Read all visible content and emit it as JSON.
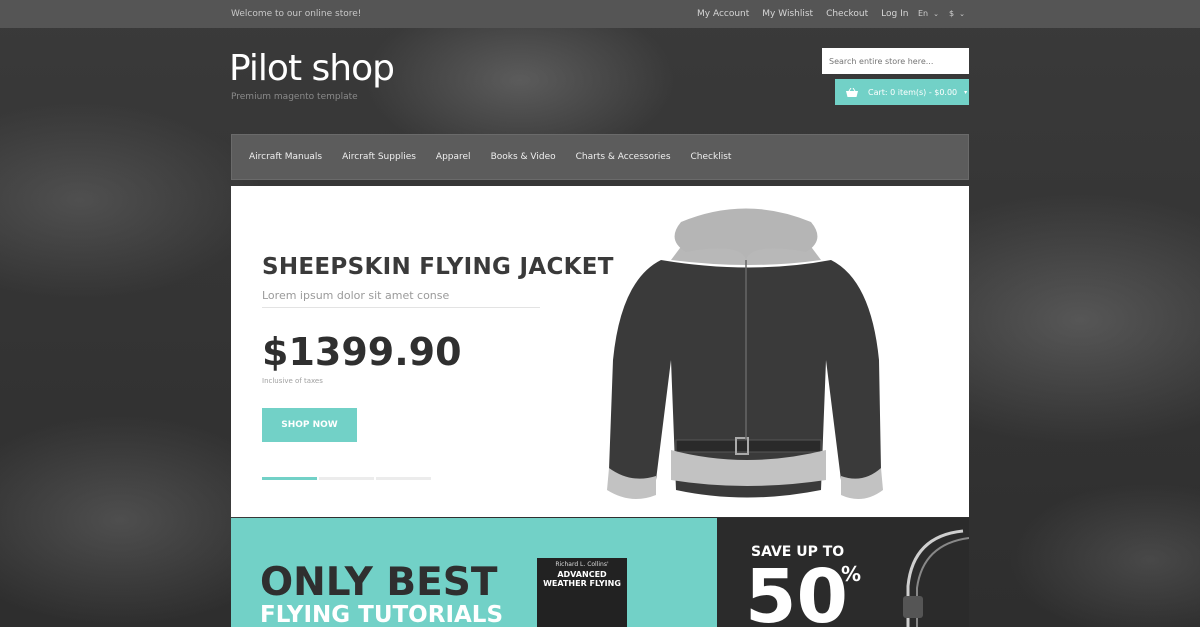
{
  "topbar": {
    "welcome": "Welcome to our online store!",
    "links": [
      "My Account",
      "My Wishlist",
      "Checkout",
      "Log In"
    ],
    "language": "En",
    "currency": "$"
  },
  "header": {
    "logo": "Pilot shop",
    "tagline": "Premium magento template",
    "search_placeholder": "Search entire store here...",
    "cart_label": "Cart:  0 item(s) - $0.00"
  },
  "nav": [
    "Aircraft Manuals",
    "Aircraft Supplies",
    "Apparel",
    "Books & Video",
    "Charts & Accessories",
    "Checklist"
  ],
  "slider": {
    "title": "SHEEPSKIN FLYING JACKET",
    "subtitle": "Lorem ipsum dolor sit amet conse",
    "price": "$1399.90",
    "tax_note": "Inclusive of taxes",
    "button": "SHOP NOW",
    "active_slide": 1,
    "slide_count": 3
  },
  "promo_left": {
    "headline": "ONLY BEST",
    "subheadline": "FLYING TUTORIALS",
    "book_author": "Richard L. Collins'",
    "book_title": "ADVANCED WEATHER FLYING"
  },
  "promo_right": {
    "save": "SAVE UP TO",
    "percent": "50",
    "percent_sign": "%"
  },
  "colors": {
    "accent": "#72d1c7",
    "topbar": "#555555",
    "nav": "#5c5c5c"
  }
}
